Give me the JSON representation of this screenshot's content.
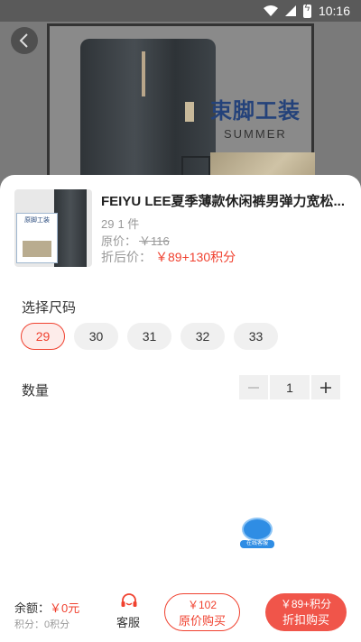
{
  "status_bar": {
    "time": "10:16"
  },
  "banner": {
    "title": "束脚工装",
    "subtitle": "SUMMER"
  },
  "product": {
    "title": "FEIYU LEE夏季薄款休闲裤男弹力宽松...",
    "spec_size": "29",
    "spec_count": "1 件",
    "original_price_label": "原价：",
    "original_price_value": "￥116",
    "discount_price_label": "折后价：",
    "discount_price_value": "￥89+130积分",
    "thumb_text": "原脚工装"
  },
  "size": {
    "label": "选择尺码",
    "options": [
      "29",
      "30",
      "31",
      "32",
      "33"
    ],
    "selected": "29"
  },
  "quantity": {
    "label": "数量",
    "value": "1"
  },
  "customer_service_float": {
    "tag": "在线客服"
  },
  "footer": {
    "balance_label": "余额：",
    "balance_value": "￥0元",
    "points_label": "积分：",
    "points_value": "0积分",
    "service_label": "客服",
    "original_buy": {
      "price": "￥102",
      "label": "原价购买"
    },
    "discount_buy": {
      "price": "￥89+积分",
      "label": "折扣购买"
    }
  },
  "colors": {
    "accent": "#f0412f",
    "discount_button": "#f0554a",
    "service_float": "#2f8de4"
  }
}
